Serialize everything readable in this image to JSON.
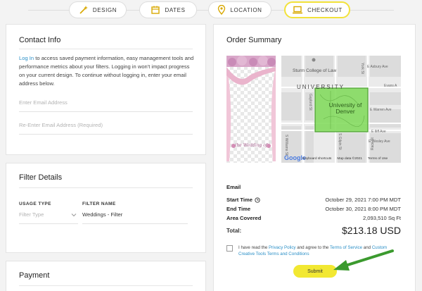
{
  "steps": [
    {
      "label": "DESIGN",
      "icon": "magic-wand-icon"
    },
    {
      "label": "DATES",
      "icon": "calendar-icon"
    },
    {
      "label": "LOCATION",
      "icon": "map-pin-icon"
    },
    {
      "label": "CHECKOUT",
      "icon": "laptop-icon",
      "active": true
    }
  ],
  "contact": {
    "title": "Contact Info",
    "login_link": "Log In",
    "body": "to access saved payment information, easy management tools and performance metrics about your filters. Logging in won't impact progress on your current design. To continue without logging in, enter your email address below.",
    "email_placeholder": "Enter Email Address",
    "email_confirm_placeholder": "Re-Enter Email Address (Required)"
  },
  "filter": {
    "title": "Filter Details",
    "usage_label": "USAGE TYPE",
    "usage_placeholder": "Filter Type",
    "name_label": "FILTER NAME",
    "name_value": "Weddings - Filter"
  },
  "payment": {
    "title": "Payment"
  },
  "summary": {
    "title": "Order Summary",
    "preview_text": "the Wedding of",
    "map": {
      "college": "Sturm College of Law",
      "university_text": "UNIVERSITY",
      "highlight": "University of Denver",
      "streets": [
        "E Asbury Ave",
        "Evans A",
        "E Warren Ave",
        "E Iliff Ave",
        "E Wesley Ave",
        "York St",
        "Race St",
        "Gaylord St",
        "S Williams St",
        "S Gilpin St"
      ],
      "google": "Google",
      "footer": [
        "Keyboard shortcuts",
        "Map data ©2021",
        "Terms of Use"
      ]
    },
    "email_label": "Email",
    "start_label": "Start Time",
    "start_value": "October 29, 2021 7:00 PM  MDT",
    "end_label": "End Time",
    "end_value": "October 30, 2021 8:00 PM  MDT",
    "area_label": "Area Covered",
    "area_value": "2,093,510 Sq Ft",
    "total_label": "Total:",
    "total_value": "$213.18 USD",
    "agree_pre": "I have read the",
    "privacy_link": "Privacy Policy",
    "agree_mid": "and agree to the",
    "terms_link": "Terms of Service",
    "agree_and": "and",
    "custom_terms_link": "Custom Creative Tools Terms and Conditions",
    "submit_label": "Submit"
  },
  "colors": {
    "accent": "#f2e832",
    "link": "#2a8fc7",
    "highlight": "#7ed957",
    "arrow": "#3b9a2e"
  }
}
